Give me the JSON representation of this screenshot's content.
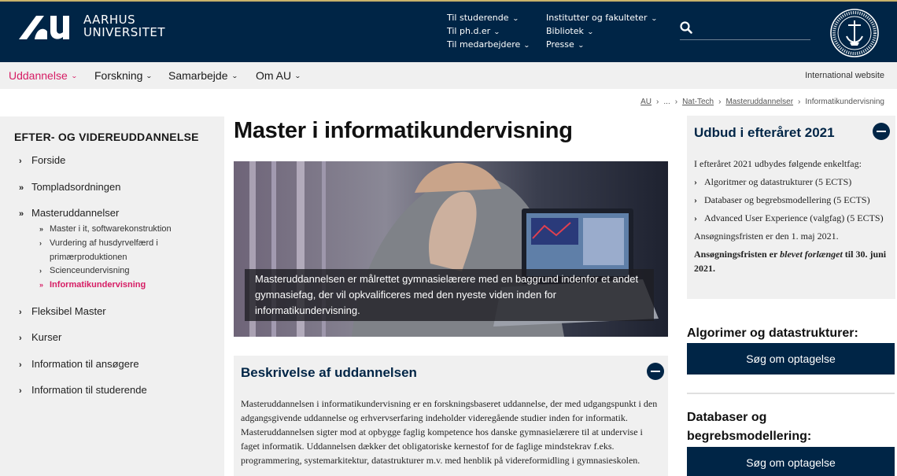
{
  "header": {
    "logo_line1": "AARHUS",
    "logo_line2": "UNIVERSITET",
    "links_col1": [
      "Til studerende",
      "Til ph.d.er",
      "Til medarbejdere"
    ],
    "links_col2": [
      "Institutter og fakulteter",
      "Bibliotek",
      "Presse"
    ],
    "search_icon": "search-icon",
    "seal_icon": "university-seal-icon",
    "colors": {
      "navy": "#002546",
      "accent": "#d61c64",
      "gold": "#c8b26a"
    }
  },
  "mainnav": {
    "items": [
      "Uddannelse",
      "Forskning",
      "Samarbejde",
      "Om AU"
    ],
    "active": "Uddannelse",
    "international": "International website"
  },
  "breadcrumb": [
    "AU",
    "...",
    "Nat-Tech",
    "Masteruddannelser",
    "Informatikundervisning"
  ],
  "sidebar": {
    "title": "EFTER- OG VIDEREUDDANNELSE",
    "items": [
      "Forside",
      "Tompladsordningen",
      "Masteruddannelser",
      "Fleksibel Master",
      "Kurser",
      "Information til ansøgere",
      "Information til studerende"
    ],
    "subitems": [
      "Master i it, softwarekonstruktion",
      "Vurdering af husdyrvelfærd i",
      "primærproduktionen",
      "Scienceundervisning",
      "Informatikundervisning"
    ]
  },
  "main": {
    "title": "Master i informatikundervisning",
    "hero_caption": "Masteruddannelsen er målrettet gymnasielærere med en baggrund indenfor et andet gymnasiefag, der vil opkvalificeres med den nyeste viden inden for informatikundervisning.",
    "description_heading": "Beskrivelse af uddannelsen",
    "description_text": "Masteruddannelsen i informatikundervisning er en forskningsbaseret uddannelse, der med udgangspunkt i den adgangsgivende uddannelse og erhvervserfaring indeholder videregående studier inden for informatik. Masteruddannelsen sigter mod at opbygge faglig kompetence hos danske gymnasielærere til at undervise i faget informatik. Uddannelsen dækker det obligatoriske kernestof for de faglige mindstekrav f.eks. programmering, systemarkitektur, datastrukturer m.v. med henblik på videreformidling i gymnasieskolen."
  },
  "aside": {
    "udbud_heading": "Udbud i efteråret 2021",
    "udbud_intro": "I efteråret 2021 udbydes følgende enkeltfag:",
    "courses": [
      "Algoritmer og datastrukturer (5 ECTS)",
      "Databaser og begrebsmodellering (5 ECTS)",
      "Advanced User Experience (valgfag) (5 ECTS)"
    ],
    "deadline_text": "Ansøgningsfristen er den 1. maj 2021.",
    "deadline_ext_1": "Ansøgningsfristen er ",
    "deadline_ext_em": "blevet forlænget",
    "deadline_ext_2": " til 30. juni 2021.",
    "course1_title": "Algorimer og datastrukturer:",
    "course2_title_a": "Databaser og",
    "course2_title_b": "begrebsmodellering:",
    "apply_label": "Søg om optagelse"
  }
}
